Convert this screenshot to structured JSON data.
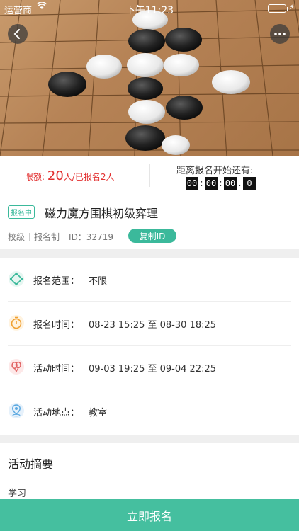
{
  "status_bar": {
    "carrier": "运营商",
    "time": "下午11:23"
  },
  "hero": {
    "alt": "围棋"
  },
  "quota": {
    "label": "限额:",
    "count": "20",
    "suffix": "人/已报名2人"
  },
  "countdown": {
    "label": "距离报名开始还有:",
    "digits": [
      "00",
      "00",
      "00",
      "0"
    ]
  },
  "event": {
    "status_tag": "报名中",
    "title": "磁力魔方围棋初级弈理",
    "meta": [
      "校级",
      "报名制",
      "ID：32719"
    ],
    "copy_id_label": "复制ID"
  },
  "info": [
    {
      "icon": "scope-icon",
      "label": "报名范围：",
      "value": "不限",
      "color": "#3bb99b"
    },
    {
      "icon": "timer-icon",
      "label": "报名时间：",
      "value": "08-23 15:25 至 08-30 18:25",
      "color": "#f0a030"
    },
    {
      "icon": "balloon-icon",
      "label": "活动时间：",
      "value": "09-03 19:25 至 09-04 22:25",
      "color": "#e06060"
    },
    {
      "icon": "location-icon",
      "label": "活动地点：",
      "value": "教室",
      "color": "#5aa8e0"
    }
  ],
  "summary": {
    "title": "活动摘要",
    "text": "学习"
  },
  "signup_label": "立即报名"
}
